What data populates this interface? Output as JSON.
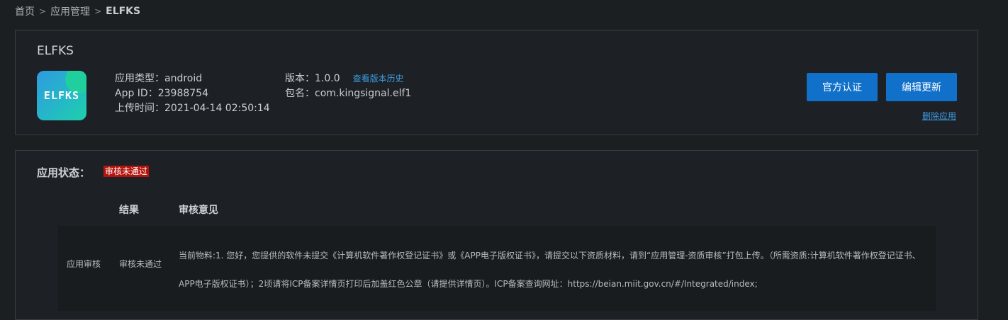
{
  "breadcrumb": {
    "home": "首页",
    "apps": "应用管理",
    "current": "ELFKS",
    "separator": ">"
  },
  "app": {
    "title": "ELFKS",
    "icon_text": "ELFKS",
    "type_label": "应用类型：",
    "type_value": "android",
    "id_label": "App ID：",
    "id_value": "23988754",
    "upload_label": "上传时间：",
    "upload_value": "2021-04-14 02:50:14",
    "version_label": "版本：",
    "version_value": "1.0.0",
    "version_history_link": "查看版本历史",
    "package_label": "包名：",
    "package_value": "com.kingsignal.elf1"
  },
  "actions": {
    "official_cert": "官方认证",
    "edit_update": "编辑更新",
    "delete_app": "删除应用"
  },
  "status": {
    "label": "应用状态：",
    "badge": "审核未通过",
    "badge_color": "#b5140e"
  },
  "review_table": {
    "headers": {
      "result": "结果",
      "opinion": "审核意见"
    },
    "rows": [
      {
        "type": "应用审核",
        "result": "审核未通过",
        "opinion": "当前物料:1. 您好，您提供的软件未提交《计算机软件著作权登记证书》或《APP电子版权证书》，请提交以下资质材料，请到“应用管理-资质审核”打包上传。（所需资质:计算机软件著作权登记证书、APP电子版权证书）；2顷请将ICP备案详情页打印后加盖红色公章（请提供详情页）。ICP备案查询网址：https://beian.miit.gov.cn/#/Integrated/index;"
      }
    ]
  },
  "colors": {
    "background": "#1b1f22",
    "accent": "#1170c9",
    "link": "#3d9be0"
  }
}
